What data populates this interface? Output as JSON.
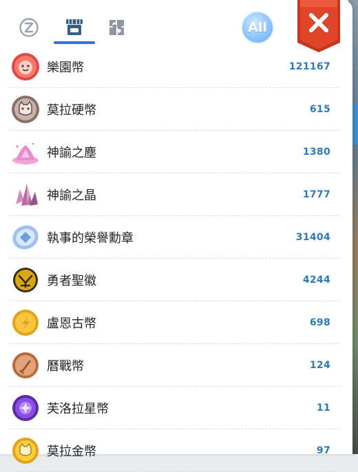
{
  "tabs": [
    {
      "name": "zeny",
      "icon": "zeny-coin-icon",
      "selected": false
    },
    {
      "name": "shop",
      "icon": "shop-icon",
      "selected": true
    },
    {
      "name": "puzzle",
      "icon": "puzzle-icon",
      "selected": false
    }
  ],
  "filter": {
    "all_label": "All"
  },
  "close": {
    "icon": "close-icon",
    "color": "#e0452a"
  },
  "accent": "#2e7ab8",
  "items": [
    {
      "name": "樂園幣",
      "qty": "121167",
      "icon": "paradise-coin-icon"
    },
    {
      "name": "莫拉硬幣",
      "qty": "615",
      "icon": "mora-coin-icon"
    },
    {
      "name": "神諭之塵",
      "qty": "1380",
      "icon": "oracle-dust-icon"
    },
    {
      "name": "神諭之晶",
      "qty": "1777",
      "icon": "oracle-crystal-icon"
    },
    {
      "name": "執事的榮譽勳章",
      "qty": "31404",
      "icon": "butler-medal-icon"
    },
    {
      "name": "勇者聖徽",
      "qty": "4244",
      "icon": "hero-emblem-icon"
    },
    {
      "name": "盧恩古幣",
      "qty": "698",
      "icon": "rune-coin-icon"
    },
    {
      "name": "曆戰幣",
      "qty": "124",
      "icon": "veteran-coin-icon"
    },
    {
      "name": "芙洛拉星幣",
      "qty": "11",
      "icon": "flora-star-coin-icon"
    },
    {
      "name": "莫拉金幣",
      "qty": "97",
      "icon": "mora-gold-coin-icon"
    }
  ]
}
